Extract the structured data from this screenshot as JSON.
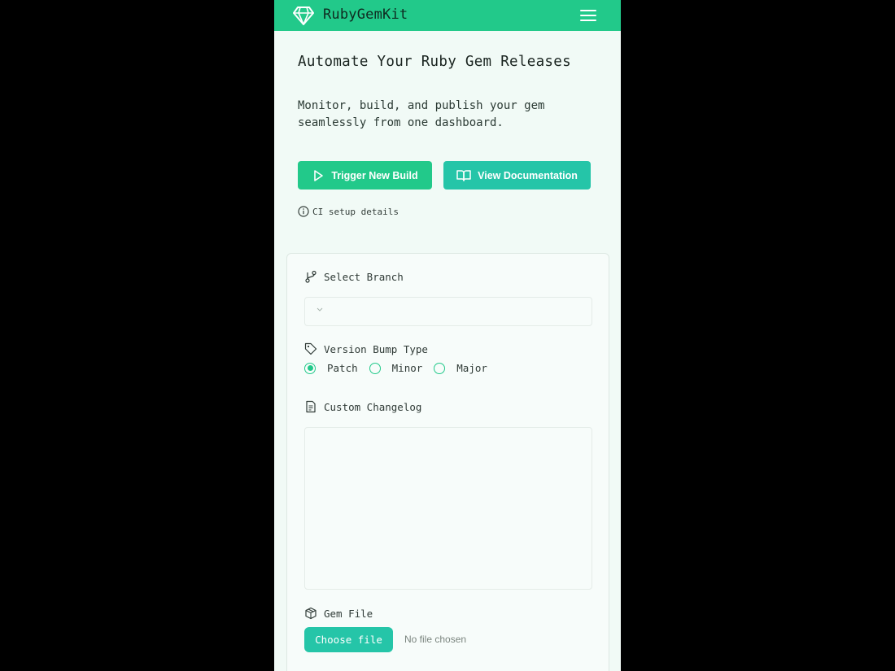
{
  "header": {
    "brand": "RubyGemKit",
    "brand_icon": "diamond-icon",
    "menu_icon": "hamburger-menu-icon",
    "color": "#22c98a"
  },
  "hero": {
    "title": "Automate Your Ruby Gem Releases",
    "subtitle": "Monitor, build, and publish your gem seamlessly from one dashboard."
  },
  "actions": {
    "trigger_build": "Trigger New Build",
    "view_docs": "View Documentation"
  },
  "ci_link": "CI setup details",
  "form": {
    "branch": {
      "label": "Select Branch",
      "selected": ""
    },
    "version_bump": {
      "label": "Version Bump Type",
      "options": [
        "Patch",
        "Minor",
        "Major"
      ],
      "selected": "Patch"
    },
    "changelog": {
      "label": "Custom Changelog",
      "value": ""
    },
    "gem_file": {
      "label": "Gem File",
      "button": "Choose file",
      "status": "No file chosen"
    }
  },
  "colors": {
    "primary": "#22c98a",
    "secondary": "#25c5a8",
    "background": "#f1faf6"
  }
}
